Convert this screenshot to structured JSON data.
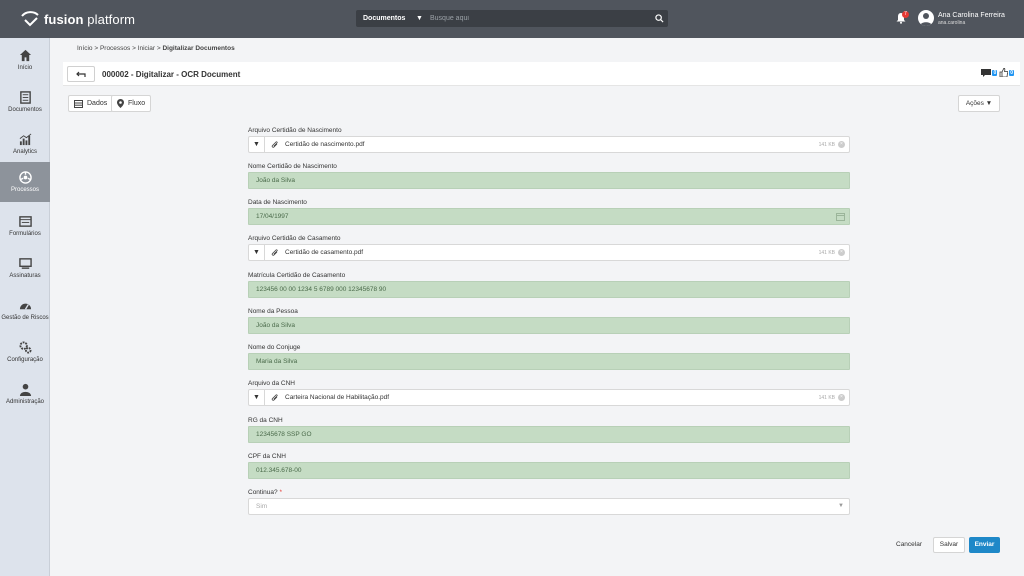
{
  "app": {
    "brand_bold": "fusion",
    "brand_light": " platform"
  },
  "search": {
    "category": "Documentos",
    "placeholder": "Busque aqui"
  },
  "notifications": {
    "count": "7"
  },
  "user": {
    "name": "Ana Carolina Ferreira",
    "login": "ana.carolina"
  },
  "sidebar": {
    "items": [
      {
        "label": "Início",
        "icon": "home-icon"
      },
      {
        "label": "Documentos",
        "icon": "document-icon"
      },
      {
        "label": "Analytics",
        "icon": "analytics-icon"
      },
      {
        "label": "Processos",
        "icon": "process-icon",
        "active": true
      },
      {
        "label": "Formulários",
        "icon": "form-icon"
      },
      {
        "label": "Assinaturas",
        "icon": "signature-icon"
      },
      {
        "label": "Gestão de Riscos",
        "icon": "gauge-icon"
      },
      {
        "label": "Configuração",
        "icon": "gears-icon"
      },
      {
        "label": "Administração",
        "icon": "user-icon"
      }
    ]
  },
  "breadcrumb": {
    "path": "Início > Processos > Iniciar > ",
    "current": "Digitalizar Documentos"
  },
  "page": {
    "title": "000002 - Digitalizar - OCR Document",
    "badge_comments": "0",
    "badge_likes": "0"
  },
  "tabs": {
    "dados": "Dados",
    "fluxo": "Fluxo"
  },
  "actions": {
    "label": "Ações"
  },
  "form": {
    "arquivo_nascimento_label": "Arquivo Certidão de Nascimento",
    "arquivo_nascimento_file": "Certidão de nascimento.pdf",
    "arquivo_nascimento_size": "141 KB",
    "nome_certidao_label": "Nome Certidão de Nascimento",
    "nome_certidao_value": "João da Silva",
    "data_nascimento_label": "Data de Nascimento",
    "data_nascimento_value": "17/04/1997",
    "arquivo_casamento_label": "Arquivo Certidão de Casamento",
    "arquivo_casamento_file": "Certidão de casamento.pdf",
    "arquivo_casamento_size": "141 KB",
    "matricula_label": "Matrícula Certidão de Casamento",
    "matricula_value": "123456 00 00 1234 5 6789 000 12345678 90",
    "nome_pessoa_label": "Nome da Pessoa",
    "nome_pessoa_value": "João da Silva",
    "nome_conjuge_label": "Nome do Conjuge",
    "nome_conjuge_value": "Maria da Silva",
    "arquivo_cnh_label": "Arquivo da CNH",
    "arquivo_cnh_file": "Carteira Nacional de Habilitação.pdf",
    "arquivo_cnh_size": "141 KB",
    "rg_label": "RG da CNH",
    "rg_value": "12345678 SSP GO",
    "cpf_label": "CPF da CNH",
    "cpf_value": "012.345.678-00",
    "continua_label": "Continua?",
    "continua_required": "*",
    "continua_value": "Sim"
  },
  "footer": {
    "cancel": "Cancelar",
    "save": "Salvar",
    "send": "Enviar"
  },
  "colors": {
    "topbar": "#50555d",
    "sidebar": "#dde3ec",
    "active_nav": "#8d939b",
    "ocr_field": "#c5dcc4",
    "primary": "#1e88c8"
  }
}
